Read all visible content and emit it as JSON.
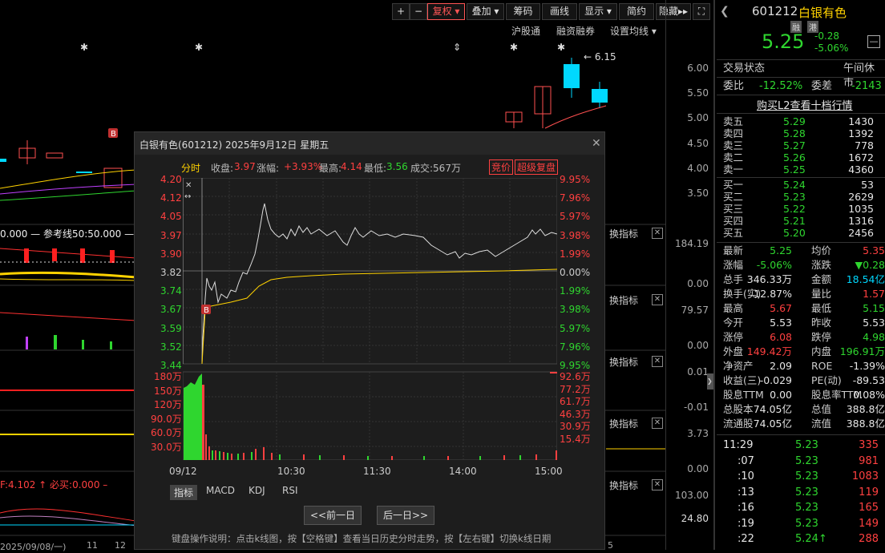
{
  "toolbar": {
    "plus": "+",
    "minus": "−",
    "fuquan": "复权",
    "diejia": "叠加",
    "chouma": "筹码",
    "huaxian": "画线",
    "xianshi": "显示",
    "jianyue": "简约",
    "yincang": "隐藏"
  },
  "links": {
    "hugutong": "沪股通",
    "rongzi": "融资融券",
    "junxian": "设置均线"
  },
  "price_axis": [
    "6.00",
    "5.50",
    "5.00",
    "4.50",
    "4.00",
    "3.50"
  ],
  "candle_label": "← 6.15",
  "ref_line": "0.000 — 参考线50:50.000 —",
  "panel_tags": {
    "tab": "换指标",
    "vals": [
      "184.19",
      "0.00",
      "79.57",
      "0.00",
      "0.01",
      "-0.01",
      "3.73",
      "0.00",
      "103.00",
      "24.80"
    ]
  },
  "bottom_left": {
    "line1": "F:4.102 ↑ 必买:0.000 –",
    "date": "2025/09/08/一)",
    "d11": "11",
    "d12": "12",
    "d5": "5"
  },
  "popup": {
    "title": "白银有色(601212) 2025年9月12日 星期五",
    "fenshi": "分时",
    "shoupan_l": "收盘:",
    "shoupan": "3.97",
    "zhangfu_l": "涨幅:",
    "zhangfu": "+3.93%",
    "zuigao_l": "最高:",
    "zuigao": "4.14",
    "zuidi_l": "最低:",
    "zuidi": "3.56",
    "chengjiao": "成交:567万",
    "jingjia": "竞价",
    "chaoji": "超级复盘",
    "y_left": [
      "4.20",
      "4.12",
      "4.05",
      "3.97",
      "3.90",
      "3.82",
      "3.74",
      "3.67",
      "3.59",
      "3.52",
      "3.44"
    ],
    "y_right": [
      "9.95%",
      "7.96%",
      "5.97%",
      "3.98%",
      "1.99%",
      "0.00%",
      "1.99%",
      "3.98%",
      "5.97%",
      "7.96%",
      "9.95%"
    ],
    "vol_left": [
      "180万",
      "150万",
      "120万",
      "90.0万",
      "60.0万",
      "30.0万"
    ],
    "vol_right": [
      "92.6万",
      "77.2万",
      "61.7万",
      "46.3万",
      "30.9万",
      "15.4万"
    ],
    "x_labels": [
      "09/12",
      "10:30",
      "11:30",
      "14:00",
      "15:00"
    ],
    "tabs": [
      "指标",
      "MACD",
      "KDJ",
      "RSI"
    ],
    "prev": "<<前一日",
    "next": "后一日>>",
    "hint": "键盘操作说明：点击k线图，按【空格键】查看当日历史分时走势，按【左右键】切换k线日期",
    "b": "B"
  },
  "right": {
    "code": "601212",
    "name": "白银有色",
    "tag1": "融",
    "tag2": "港",
    "price": "5.25",
    "chg": "-0.28",
    "pct": "-5.06%",
    "status_l": "交易状态",
    "status": "午间休市",
    "weibi_l": "委比",
    "weibi": "-12.52%",
    "weicha_l": "委差",
    "weicha": "-2143",
    "l2": "购买L2查看十档行情",
    "asks": [
      {
        "n": "卖五",
        "p": "5.29",
        "v": "1430"
      },
      {
        "n": "卖四",
        "p": "5.28",
        "v": "1392"
      },
      {
        "n": "卖三",
        "p": "5.27",
        "v": "778"
      },
      {
        "n": "卖二",
        "p": "5.26",
        "v": "1672"
      },
      {
        "n": "卖一",
        "p": "5.25",
        "v": "4360"
      }
    ],
    "bids": [
      {
        "n": "买一",
        "p": "5.24",
        "v": "53"
      },
      {
        "n": "买二",
        "p": "5.23",
        "v": "2629"
      },
      {
        "n": "买三",
        "p": "5.22",
        "v": "1035"
      },
      {
        "n": "买四",
        "p": "5.21",
        "v": "1316"
      },
      {
        "n": "买五",
        "p": "5.20",
        "v": "2456"
      }
    ],
    "stats": [
      {
        "a": "最新",
        "av": "5.25",
        "ac": "grn",
        "b": "均价",
        "bv": "5.35",
        "bc": "red"
      },
      {
        "a": "涨幅",
        "av": "-5.06%",
        "ac": "grn",
        "b": "涨跌",
        "bv": "▼0.28",
        "bc": "grn"
      },
      {
        "a": "总手",
        "av": "346.33万",
        "ac": "wht",
        "b": "金额",
        "bv": "18.54亿",
        "bc": "cyan"
      },
      {
        "a": "换手(实)",
        "av": "12.87%",
        "ac": "wht",
        "b": "量比",
        "bv": "1.57",
        "bc": "red"
      },
      {
        "a": "最高",
        "av": "5.67",
        "ac": "red",
        "b": "最低",
        "bv": "5.15",
        "bc": "grn"
      },
      {
        "a": "今开",
        "av": "5.53",
        "ac": "wht",
        "b": "昨收",
        "bv": "5.53",
        "bc": "wht"
      },
      {
        "a": "涨停",
        "av": "6.08",
        "ac": "red",
        "b": "跌停",
        "bv": "4.98",
        "bc": "grn"
      },
      {
        "a": "外盘",
        "av": "149.42万",
        "ac": "red",
        "b": "内盘",
        "bv": "196.91万",
        "bc": "grn"
      },
      {
        "a": "净资产",
        "av": "2.09",
        "ac": "wht",
        "b": "ROE",
        "bv": "-1.39%",
        "bc": "wht"
      },
      {
        "a": "收益(三)",
        "av": "-0.029",
        "ac": "wht",
        "b": "PE(动)",
        "bv": "-89.53",
        "bc": "wht"
      },
      {
        "a": "股息TTM",
        "av": "0.00",
        "ac": "wht",
        "b": "股息率TTM",
        "bv": "0.08%",
        "bc": "wht"
      },
      {
        "a": "总股本",
        "av": "74.05亿",
        "ac": "wht",
        "b": "总值",
        "bv": "388.8亿",
        "bc": "wht"
      },
      {
        "a": "流通股",
        "av": "74.05亿",
        "ac": "wht",
        "b": "流值",
        "bv": "388.8亿",
        "bc": "wht"
      }
    ],
    "ticks": [
      {
        "t": "11:29",
        "p": "5.23",
        "v": "335"
      },
      {
        "t": ":07",
        "p": "5.23",
        "v": "981"
      },
      {
        "t": ":10",
        "p": "5.23",
        "v": "1083"
      },
      {
        "t": ":13",
        "p": "5.23",
        "v": "119"
      },
      {
        "t": ":16",
        "p": "5.23",
        "v": "165"
      },
      {
        "t": ":19",
        "p": "5.23",
        "v": "149"
      },
      {
        "t": ":22",
        "p": "5.24↑",
        "v": "288"
      }
    ]
  }
}
